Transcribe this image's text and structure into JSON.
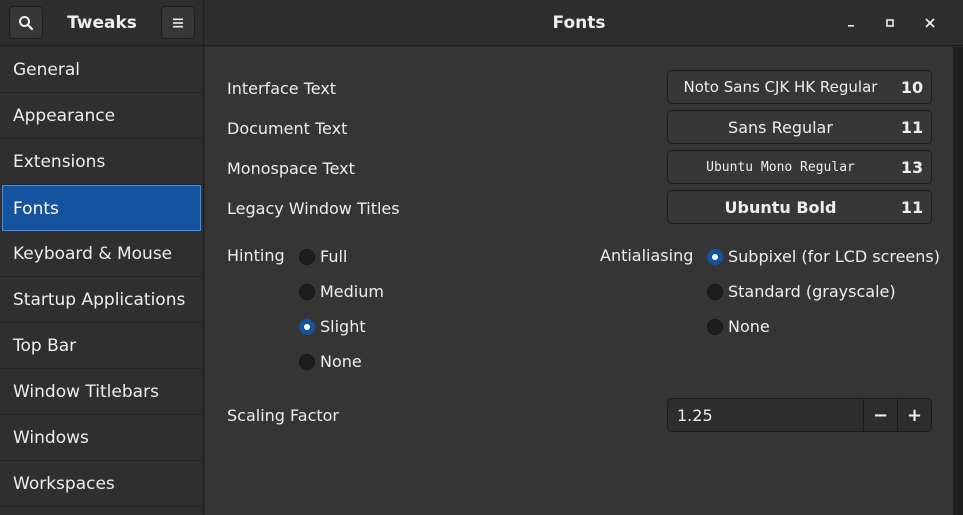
{
  "header": {
    "app_title": "Tweaks",
    "page_title": "Fonts",
    "search_icon": "search-icon",
    "menu_icon": "hamburger-menu-icon",
    "controls": [
      "minimize-icon",
      "maximize-icon",
      "close-icon"
    ]
  },
  "sidebar": {
    "items": [
      {
        "label": "General"
      },
      {
        "label": "Appearance"
      },
      {
        "label": "Extensions"
      },
      {
        "label": "Fonts",
        "active": true
      },
      {
        "label": "Keyboard & Mouse"
      },
      {
        "label": "Startup Applications"
      },
      {
        "label": "Top Bar"
      },
      {
        "label": "Window Titlebars"
      },
      {
        "label": "Windows"
      },
      {
        "label": "Workspaces"
      }
    ]
  },
  "fonts": {
    "interface": {
      "label": "Interface Text",
      "font": "Noto Sans CJK HK Regular",
      "size": "10"
    },
    "document": {
      "label": "Document Text",
      "font": "Sans Regular",
      "size": "11"
    },
    "monospace": {
      "label": "Monospace Text",
      "font": "Ubuntu Mono Regular",
      "size": "13"
    },
    "legacy": {
      "label": "Legacy Window Titles",
      "font": "Ubuntu Bold",
      "size": "11"
    }
  },
  "hinting": {
    "label": "Hinting",
    "options": [
      "Full",
      "Medium",
      "Slight",
      "None"
    ],
    "selected": "Slight"
  },
  "antialiasing": {
    "label": "Antialiasing",
    "options": [
      "Subpixel (for LCD screens)",
      "Standard (grayscale)",
      "None"
    ],
    "selected": "Subpixel (for LCD screens)"
  },
  "scaling": {
    "label": "Scaling Factor",
    "value": "1.25",
    "decrement": "−",
    "increment": "+"
  },
  "colors": {
    "accent": "#15539e",
    "background": "#353535",
    "sidebar": "#2f2f2f"
  }
}
